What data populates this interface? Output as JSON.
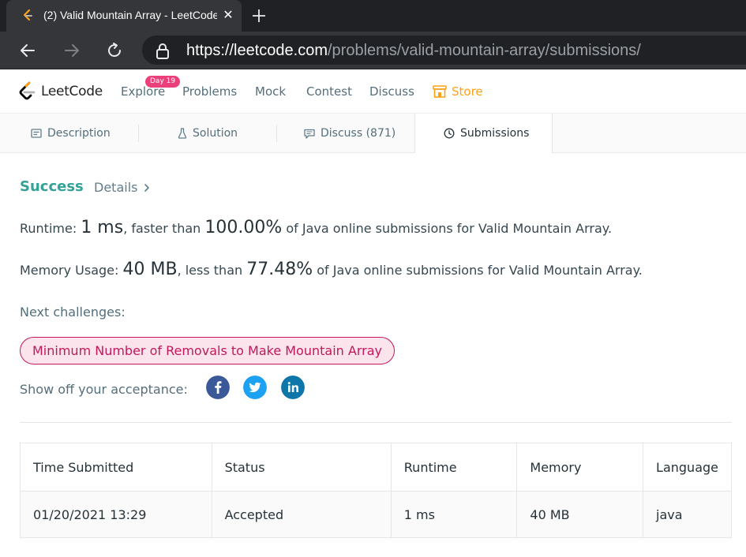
{
  "browser": {
    "tab_title": "(2) Valid Mountain Array - LeetCode",
    "url_scheme": "https://",
    "url_host": "leetcode.com",
    "url_path": "/problems/valid-mountain-array/submissions/"
  },
  "nav": {
    "brand": "LeetCode",
    "explore": "Explore",
    "explore_badge": "Day 19",
    "problems": "Problems",
    "mock": "Mock",
    "contest": "Contest",
    "discuss": "Discuss",
    "store": "Store"
  },
  "tabs": {
    "description": "Description",
    "solution": "Solution",
    "discuss": "Discuss (871)",
    "submissions": "Submissions"
  },
  "result": {
    "status": "Success",
    "details": "Details",
    "runtime_label": "Runtime:",
    "runtime_value": "1 ms",
    "runtime_mid": ", faster than",
    "runtime_pct": "100.00%",
    "runtime_tail": "of Java online submissions for Valid Mountain Array.",
    "memory_label": "Memory Usage:",
    "memory_value": "40 MB",
    "memory_mid": ", less than",
    "memory_pct": "77.48%",
    "memory_tail": "of Java online submissions for Valid Mountain Array.",
    "next_label": "Next challenges:",
    "next_challenge": "Minimum Number of Removals to Make Mountain Array",
    "share_label": "Show off your acceptance:"
  },
  "table": {
    "headers": [
      "Time Submitted",
      "Status",
      "Runtime",
      "Memory",
      "Language"
    ],
    "rows": [
      [
        "01/20/2021 13:29",
        "Accepted",
        "1 ms",
        "40 MB",
        "java"
      ]
    ]
  },
  "colors": {
    "accent_green": "#34a297",
    "challenge_pink": "#c2185b",
    "store_orange": "#ffa116",
    "facebook": "#3b5998",
    "twitter": "#1da1f2",
    "linkedin": "#0e76a8"
  }
}
